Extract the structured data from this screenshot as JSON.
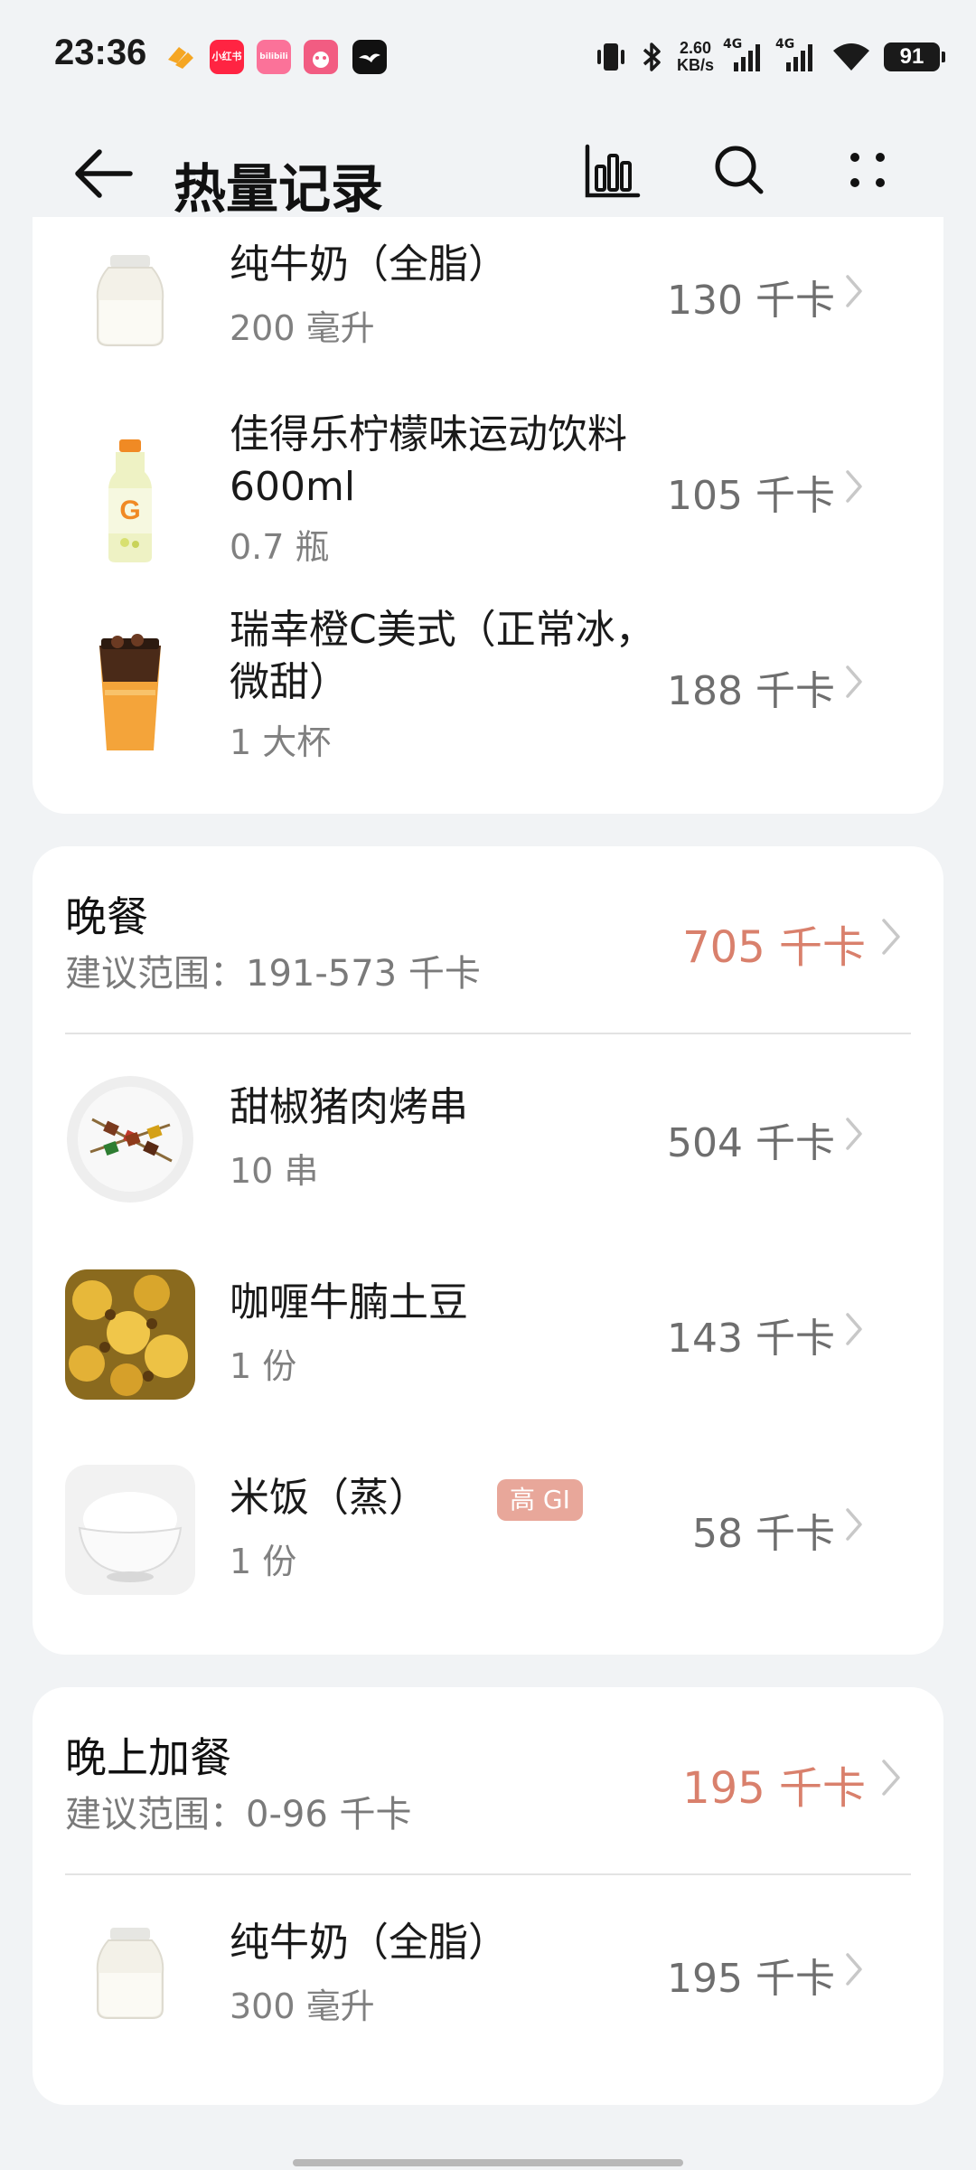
{
  "status_bar": {
    "time": "23:36",
    "app_icons": [
      {
        "name": "orange-app-icon",
        "label": "",
        "color": "#f59a23"
      },
      {
        "name": "xiaohongshu-icon",
        "label": "小红书",
        "color": "#ff2442"
      },
      {
        "name": "bilibili-icon",
        "label": "bilibili",
        "color": "#fb7299"
      },
      {
        "name": "pink-app-icon",
        "label": "",
        "color": "#f25c82"
      },
      {
        "name": "bird-app-icon",
        "label": "",
        "color": "#111111"
      }
    ],
    "net_speed_value": "2.60",
    "net_speed_unit": "KB/s",
    "network_1": "4G",
    "network_2": "4G",
    "battery": "91"
  },
  "header": {
    "title": "热量记录"
  },
  "card_top": {
    "items": [
      {
        "name": "纯牛奶（全脂）",
        "qty": "200 毫升",
        "kcal": "130 千卡"
      },
      {
        "name": "佳得乐柠檬味运动饮料600ml",
        "qty": "0.7 瓶",
        "kcal": "105 千卡"
      },
      {
        "name": "瑞幸橙C美式（正常冰，微甜）",
        "qty": "1 大杯",
        "kcal": "188 千卡"
      }
    ]
  },
  "dinner": {
    "name": "晚餐",
    "range": "建议范围：191-573 千卡",
    "kcal": "705 千卡",
    "items": [
      {
        "name": "甜椒猪肉烤串",
        "qty": "10 串",
        "kcal": "504 千卡"
      },
      {
        "name": "咖喱牛腩土豆",
        "qty": "1 份",
        "kcal": "143 千卡"
      },
      {
        "name": "米饭（蒸）",
        "qty": "1 份",
        "kcal": "58 千卡",
        "badge": "高 GI"
      }
    ]
  },
  "night_snack": {
    "name": "晚上加餐",
    "range": "建议范围：0-96 千卡",
    "kcal": "195 千卡",
    "items": [
      {
        "name": "纯牛奶（全脂）",
        "qty": "300 毫升",
        "kcal": "195 千卡"
      }
    ]
  },
  "colors": {
    "over_kcal": "#d9806c",
    "badge": "#e8a79a",
    "background": "#f1f3f5"
  }
}
